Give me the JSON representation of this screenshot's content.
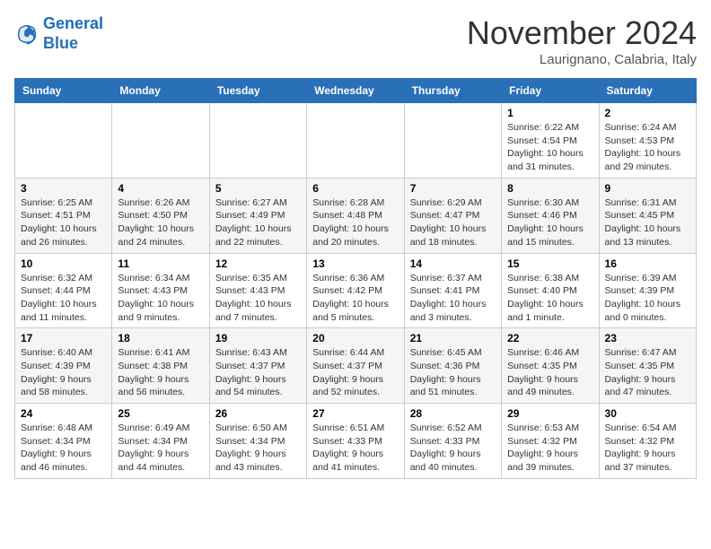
{
  "logo": {
    "line1": "General",
    "line2": "Blue"
  },
  "title": "November 2024",
  "subtitle": "Laurignano, Calabria, Italy",
  "weekdays": [
    "Sunday",
    "Monday",
    "Tuesday",
    "Wednesday",
    "Thursday",
    "Friday",
    "Saturday"
  ],
  "weeks": [
    [
      {
        "day": "",
        "info": ""
      },
      {
        "day": "",
        "info": ""
      },
      {
        "day": "",
        "info": ""
      },
      {
        "day": "",
        "info": ""
      },
      {
        "day": "",
        "info": ""
      },
      {
        "day": "1",
        "info": "Sunrise: 6:22 AM\nSunset: 4:54 PM\nDaylight: 10 hours and 31 minutes."
      },
      {
        "day": "2",
        "info": "Sunrise: 6:24 AM\nSunset: 4:53 PM\nDaylight: 10 hours and 29 minutes."
      }
    ],
    [
      {
        "day": "3",
        "info": "Sunrise: 6:25 AM\nSunset: 4:51 PM\nDaylight: 10 hours and 26 minutes."
      },
      {
        "day": "4",
        "info": "Sunrise: 6:26 AM\nSunset: 4:50 PM\nDaylight: 10 hours and 24 minutes."
      },
      {
        "day": "5",
        "info": "Sunrise: 6:27 AM\nSunset: 4:49 PM\nDaylight: 10 hours and 22 minutes."
      },
      {
        "day": "6",
        "info": "Sunrise: 6:28 AM\nSunset: 4:48 PM\nDaylight: 10 hours and 20 minutes."
      },
      {
        "day": "7",
        "info": "Sunrise: 6:29 AM\nSunset: 4:47 PM\nDaylight: 10 hours and 18 minutes."
      },
      {
        "day": "8",
        "info": "Sunrise: 6:30 AM\nSunset: 4:46 PM\nDaylight: 10 hours and 15 minutes."
      },
      {
        "day": "9",
        "info": "Sunrise: 6:31 AM\nSunset: 4:45 PM\nDaylight: 10 hours and 13 minutes."
      }
    ],
    [
      {
        "day": "10",
        "info": "Sunrise: 6:32 AM\nSunset: 4:44 PM\nDaylight: 10 hours and 11 minutes."
      },
      {
        "day": "11",
        "info": "Sunrise: 6:34 AM\nSunset: 4:43 PM\nDaylight: 10 hours and 9 minutes."
      },
      {
        "day": "12",
        "info": "Sunrise: 6:35 AM\nSunset: 4:43 PM\nDaylight: 10 hours and 7 minutes."
      },
      {
        "day": "13",
        "info": "Sunrise: 6:36 AM\nSunset: 4:42 PM\nDaylight: 10 hours and 5 minutes."
      },
      {
        "day": "14",
        "info": "Sunrise: 6:37 AM\nSunset: 4:41 PM\nDaylight: 10 hours and 3 minutes."
      },
      {
        "day": "15",
        "info": "Sunrise: 6:38 AM\nSunset: 4:40 PM\nDaylight: 10 hours and 1 minute."
      },
      {
        "day": "16",
        "info": "Sunrise: 6:39 AM\nSunset: 4:39 PM\nDaylight: 10 hours and 0 minutes."
      }
    ],
    [
      {
        "day": "17",
        "info": "Sunrise: 6:40 AM\nSunset: 4:39 PM\nDaylight: 9 hours and 58 minutes."
      },
      {
        "day": "18",
        "info": "Sunrise: 6:41 AM\nSunset: 4:38 PM\nDaylight: 9 hours and 56 minutes."
      },
      {
        "day": "19",
        "info": "Sunrise: 6:43 AM\nSunset: 4:37 PM\nDaylight: 9 hours and 54 minutes."
      },
      {
        "day": "20",
        "info": "Sunrise: 6:44 AM\nSunset: 4:37 PM\nDaylight: 9 hours and 52 minutes."
      },
      {
        "day": "21",
        "info": "Sunrise: 6:45 AM\nSunset: 4:36 PM\nDaylight: 9 hours and 51 minutes."
      },
      {
        "day": "22",
        "info": "Sunrise: 6:46 AM\nSunset: 4:35 PM\nDaylight: 9 hours and 49 minutes."
      },
      {
        "day": "23",
        "info": "Sunrise: 6:47 AM\nSunset: 4:35 PM\nDaylight: 9 hours and 47 minutes."
      }
    ],
    [
      {
        "day": "24",
        "info": "Sunrise: 6:48 AM\nSunset: 4:34 PM\nDaylight: 9 hours and 46 minutes."
      },
      {
        "day": "25",
        "info": "Sunrise: 6:49 AM\nSunset: 4:34 PM\nDaylight: 9 hours and 44 minutes."
      },
      {
        "day": "26",
        "info": "Sunrise: 6:50 AM\nSunset: 4:34 PM\nDaylight: 9 hours and 43 minutes."
      },
      {
        "day": "27",
        "info": "Sunrise: 6:51 AM\nSunset: 4:33 PM\nDaylight: 9 hours and 41 minutes."
      },
      {
        "day": "28",
        "info": "Sunrise: 6:52 AM\nSunset: 4:33 PM\nDaylight: 9 hours and 40 minutes."
      },
      {
        "day": "29",
        "info": "Sunrise: 6:53 AM\nSunset: 4:32 PM\nDaylight: 9 hours and 39 minutes."
      },
      {
        "day": "30",
        "info": "Sunrise: 6:54 AM\nSunset: 4:32 PM\nDaylight: 9 hours and 37 minutes."
      }
    ]
  ]
}
